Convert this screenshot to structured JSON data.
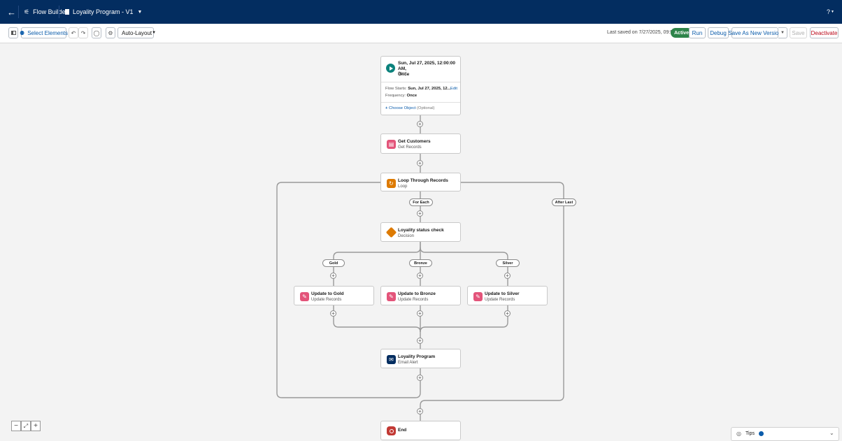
{
  "header": {
    "app_name": "Flow Builder",
    "flow_name": "Loyality Program - V1",
    "help_label": "?"
  },
  "toolbar": {
    "select_elements": "Select Elements",
    "layout": "Auto-Layout",
    "last_saved": "Last saved on 7/27/2025, 09:59 PM",
    "status": "Active",
    "run": "Run",
    "debug": "Debug",
    "save_as_new_version": "Save As New Version",
    "save": "Save",
    "deactivate": "Deactivate"
  },
  "start": {
    "title_line1": "Sun, Jul 27, 2025, 12:00:00 AM,",
    "title_line2": "Once",
    "subtitle": "Start",
    "flow_starts_label": "Flow Starts:",
    "flow_starts_value": "Sun, Jul 27, 2025, 12...",
    "edit": "Edit",
    "frequency_label": "Frequency:",
    "frequency_value": "Once",
    "choose_object": "Choose Object",
    "choose_object_hint": "(Optional)"
  },
  "nodes": {
    "get_customers": {
      "title": "Get Customers",
      "subtitle": "Get Records"
    },
    "loop": {
      "title": "Loop Through Records",
      "subtitle": "Loop"
    },
    "decision": {
      "title": "Loyality status check",
      "subtitle": "Decision"
    },
    "update_gold": {
      "title": "Update to Gold",
      "subtitle": "Update Records"
    },
    "update_bronze": {
      "title": "Update to Bronze",
      "subtitle": "Update Records"
    },
    "update_silver": {
      "title": "Update to Silver",
      "subtitle": "Update Records"
    },
    "email": {
      "title": "Loyality Program",
      "subtitle": "Email Alert"
    },
    "end": {
      "title": "End"
    }
  },
  "connectors": {
    "for_each": "For Each",
    "after_last": "After Last",
    "gold": "Gold",
    "bronze": "Bronze",
    "silver": "Silver"
  },
  "tips": {
    "label": "Tips"
  },
  "colors": {
    "header_bg": "#032d60",
    "active_badge": "#2e844a",
    "start_icon": "#0b827c",
    "record_icon": "#e3547a",
    "loop_icon": "#dd7a01",
    "decision_icon": "#dd7a01",
    "email_icon": "#032d60",
    "end_icon": "#c23934"
  }
}
